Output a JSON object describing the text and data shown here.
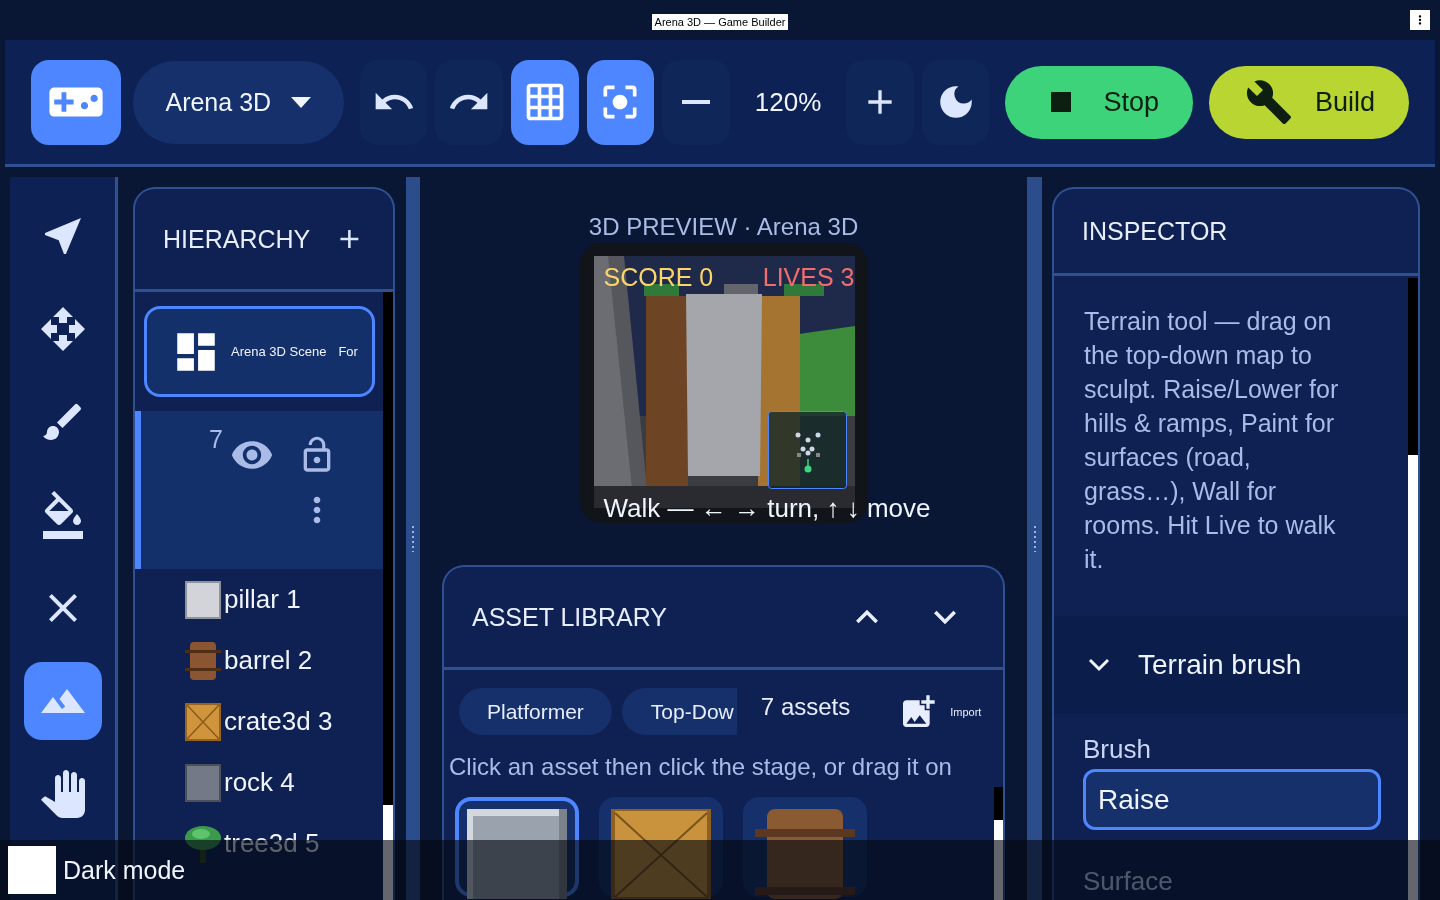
{
  "window": {
    "title": "Arena 3D — Game Builder"
  },
  "toolbar": {
    "project": "Arena 3D",
    "grid_on": true,
    "focus_on": true,
    "zoom": "120%",
    "actions": [
      {
        "kind": "stop",
        "label": "Stop"
      },
      {
        "kind": "build",
        "label": "Build"
      }
    ]
  },
  "tools": [
    {
      "kind": "select",
      "selected": false
    },
    {
      "kind": "move",
      "selected": false
    },
    {
      "kind": "brush",
      "selected": false
    },
    {
      "kind": "fill",
      "selected": false
    },
    {
      "kind": "erase",
      "selected": false
    },
    {
      "kind": "terrain",
      "selected": true
    },
    {
      "kind": "hand",
      "selected": false
    }
  ],
  "hierarchy": {
    "title": "HIERARCHY",
    "scene": {
      "name": "Arena 3D Scene",
      "extra": "For"
    },
    "group": {
      "count": "7"
    },
    "items": [
      {
        "kind": "pillar",
        "name": "pillar 1"
      },
      {
        "kind": "barrel",
        "name": "barrel 2"
      },
      {
        "kind": "crate",
        "name": "crate3d 3"
      },
      {
        "kind": "rock",
        "name": "rock 4"
      },
      {
        "kind": "tree",
        "name": "tree3d 5"
      }
    ]
  },
  "preview": {
    "title": "3D PREVIEW · Arena 3D",
    "score": "SCORE 0",
    "lives": "LIVES 3",
    "hint": "Walk — ← → turn, ↑ ↓ move"
  },
  "asset_library": {
    "title": "ASSET LIBRARY",
    "chips": [
      "Platformer",
      "Top-Dow"
    ],
    "count": "7 assets",
    "import": "Import",
    "hint": "Click an asset then click the stage, or drag it on",
    "assets": [
      {
        "kind": "stone",
        "selected": true
      },
      {
        "kind": "crate",
        "selected": false
      },
      {
        "kind": "barrel",
        "selected": false
      }
    ]
  },
  "inspector": {
    "title": "INSPECTOR",
    "description": "Terrain tool — drag on the top-down map to sculpt. Raise/Lower for hills & ramps, Paint for surfaces (road, grass…), Wall for rooms. Hit Live to walk it.",
    "section": {
      "title": "Terrain brush",
      "expanded": true
    },
    "brush_label": "Brush",
    "brush_value": "Raise",
    "next_label": "Surface"
  },
  "dark_mode": {
    "label": "Dark mode",
    "checked": false
  }
}
